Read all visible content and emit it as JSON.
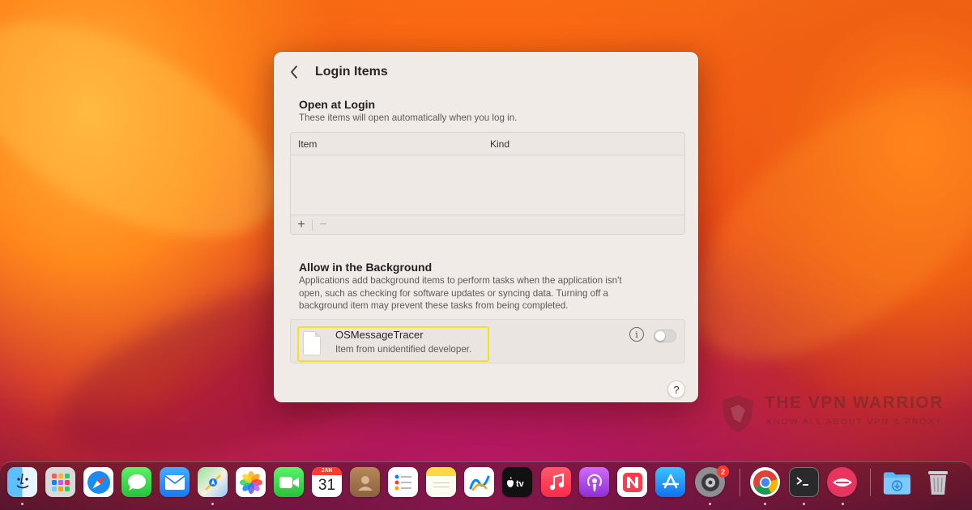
{
  "window": {
    "title": "Login Items",
    "open_at_login": {
      "title": "Open at Login",
      "description": "These items will open automatically when you log in.",
      "columns": [
        "Item",
        "Kind"
      ],
      "add_symbol": "+",
      "remove_symbol": "−"
    },
    "allow_background": {
      "title": "Allow in the Background",
      "description_lines": [
        "Applications add background items to perform tasks when the application isn't",
        "open, such as checking for software updates or syncing data. Turning off a",
        "background item may prevent these tasks from being completed."
      ],
      "item": {
        "name": "OSMessageTracer",
        "subtitle": "Item from unidentified developer.",
        "enabled": false,
        "icon": "document-icon",
        "highlight_color": "#f4e21b"
      }
    },
    "help_symbol": "?"
  },
  "watermark": {
    "title": "THE VPN WARRIOR",
    "subtitle": "KNOW ALL ABOUT VPN & PROXY"
  },
  "dock": {
    "calendar": {
      "month": "JAN",
      "day": "31"
    },
    "system_settings_badge": "2",
    "apps": [
      "finder",
      "launchpad",
      "safari",
      "messages",
      "mail",
      "maps",
      "photos",
      "facetime",
      "calendar",
      "contacts",
      "reminders",
      "notes",
      "freeform",
      "apple-tv",
      "music",
      "podcasts",
      "news",
      "app-store",
      "system-settings",
      "chrome",
      "terminal",
      "vpn-app",
      "downloads",
      "trash"
    ]
  }
}
